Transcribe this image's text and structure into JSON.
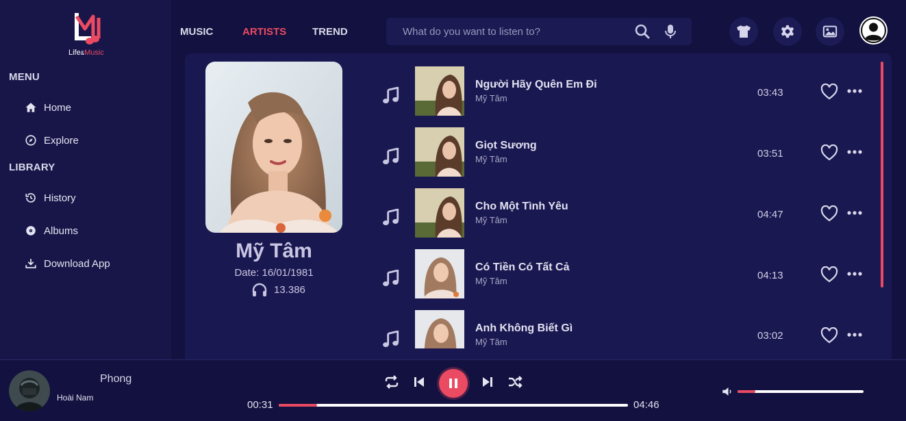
{
  "brand": {
    "logo_text_main": "Life",
    "logo_text_amp": "&",
    "logo_text_accent": "Music",
    "accent_color": "#ea4a62"
  },
  "sidebar": {
    "menu_heading": "MENU",
    "menu_items": [
      {
        "label": "Home",
        "icon": "home-icon"
      },
      {
        "label": "Explore",
        "icon": "compass-icon"
      }
    ],
    "library_heading": "LIBRARY",
    "library_items": [
      {
        "label": "History",
        "icon": "history-icon"
      },
      {
        "label": "Albums",
        "icon": "album-icon"
      },
      {
        "label": "Download App",
        "icon": "download-icon"
      }
    ]
  },
  "header": {
    "nav": [
      {
        "label": "MUSIC",
        "active": false
      },
      {
        "label": "ARTISTS",
        "active": true
      },
      {
        "label": "TREND",
        "active": false
      }
    ],
    "search": {
      "placeholder": "What do you want to listen to?",
      "value": ""
    },
    "icons": [
      "shirt-icon",
      "gear-icon",
      "image-icon",
      "user-avatar-icon"
    ]
  },
  "artist": {
    "name": "Mỹ Tâm",
    "date": "Date: 16/01/1981",
    "listens": "13.386"
  },
  "songs": [
    {
      "title": "Người Hãy Quên Em Đi",
      "artist": "Mỹ Tâm",
      "duration": "03:43"
    },
    {
      "title": "Giọt Sương",
      "artist": "Mỹ Tâm",
      "duration": "03:51"
    },
    {
      "title": "Cho Một Tình Yêu",
      "artist": "Mỹ Tâm",
      "duration": "04:47"
    },
    {
      "title": "Có Tiền Có Tất Cả",
      "artist": "Mỹ Tâm",
      "duration": "04:13"
    },
    {
      "title": "Anh Không Biết Gì",
      "artist": "Mỹ Tâm",
      "duration": "03:02"
    }
  ],
  "player": {
    "title": "Phong",
    "artist": "Hoài Nam",
    "current_time": "00:31",
    "total_time": "04:46",
    "progress": 0.11,
    "volume": 0.14,
    "state": "playing"
  }
}
